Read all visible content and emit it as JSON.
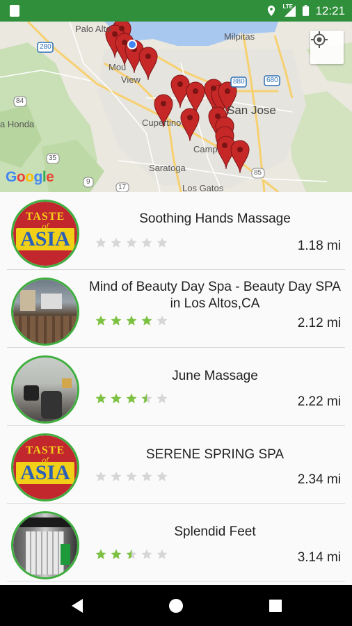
{
  "status_bar": {
    "time": "12:21",
    "icons": [
      "notification-icon",
      "location-icon",
      "lte-signal-icon",
      "battery-icon"
    ],
    "lte_label": "LTE"
  },
  "map": {
    "labels": {
      "palo_alto": "Palo Alto",
      "milpitas": "Milpitas",
      "mountain_view_a": "Mou",
      "mountain_view_b": "View",
      "cupertino": "Cupertino",
      "san_jose": "San Jose",
      "campbell": "Camp",
      "saratoga": "Saratoga",
      "los_gatos": "Los Gatos",
      "la_honda": "a Honda",
      "hw_280": "280",
      "hw_880": "880",
      "hw_680": "680",
      "hw_84": "84",
      "hw_35": "35",
      "hw_9": "9",
      "hw_85": "85",
      "hw_17": "17"
    },
    "google_logo": "Google",
    "my_location_button": "my-location-icon"
  },
  "places": [
    {
      "name": "Soothing Hands Massage",
      "rating": 0,
      "distance": "1.18 mi",
      "image": "taste-of-asia-logo"
    },
    {
      "name": "Mind of Beauty Day Spa - Beauty Day SPA in Los Altos,CA",
      "rating": 4,
      "distance": "2.12 mi",
      "image": "spa-interior-photo"
    },
    {
      "name": "June Massage",
      "rating": 3.5,
      "distance": "2.22 mi",
      "image": "massage-chairs-photo"
    },
    {
      "name": "SERENE SPRING SPA",
      "rating": 0,
      "distance": "2.34 mi",
      "image": "taste-of-asia-logo"
    },
    {
      "name": "Splendid Feet",
      "rating": 2.5,
      "distance": "3.14 mi",
      "image": "storefront-photo"
    }
  ],
  "taste_of_asia": {
    "line1": "TASTE",
    "line2": "of",
    "line3": "ASIA"
  },
  "colors": {
    "status_bar": "#2f8f3b",
    "accent_green": "#3fae3f",
    "star_filled": "#7cc142",
    "star_empty": "#d6d6d6",
    "pin_red": "#d42a2a"
  },
  "nav_bar": {
    "icons": [
      "back-icon",
      "home-icon",
      "recents-icon"
    ]
  }
}
